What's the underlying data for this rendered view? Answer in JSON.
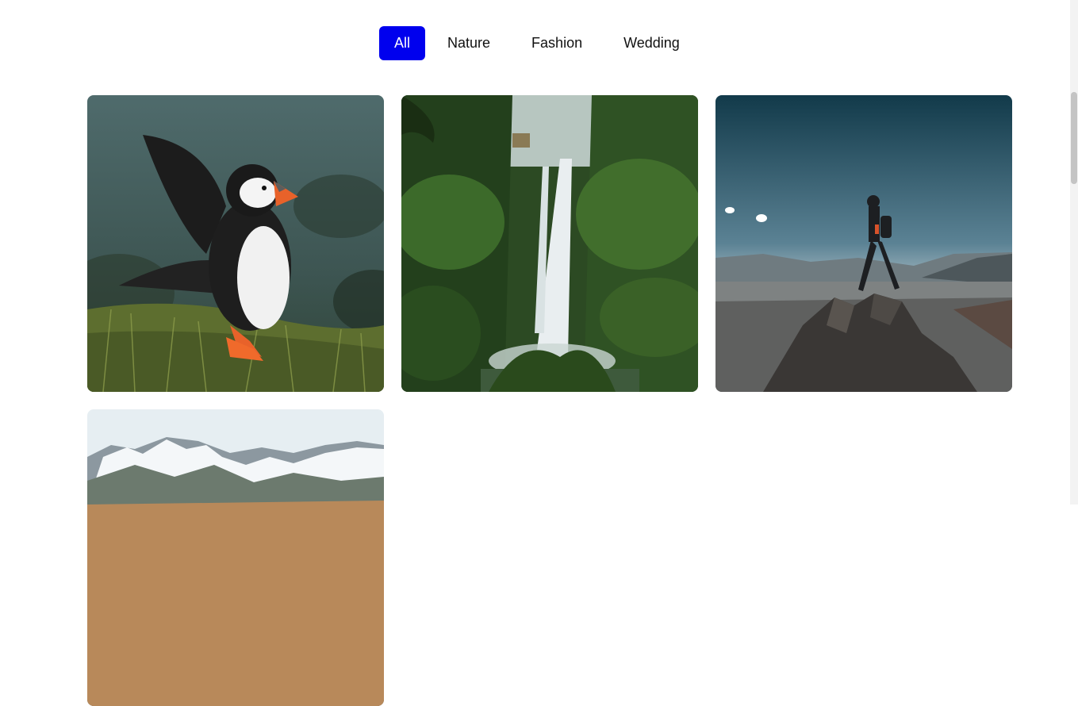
{
  "filters": {
    "items": [
      {
        "label": "All",
        "active": true
      },
      {
        "label": "Nature",
        "active": false
      },
      {
        "label": "Fashion",
        "active": false
      },
      {
        "label": "Wedding",
        "active": false
      }
    ],
    "accent_color": "#0000ee"
  },
  "gallery": {
    "images": [
      {
        "subject": "puffin"
      },
      {
        "subject": "waterfall"
      },
      {
        "subject": "hiker-on-peak"
      },
      {
        "subject": "snowy-mountains"
      }
    ]
  }
}
